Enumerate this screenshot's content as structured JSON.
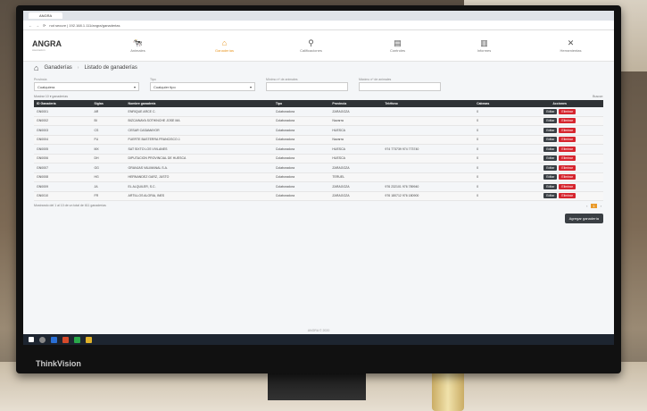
{
  "browser": {
    "tab_title": "ANGRA",
    "url": "not secure | 192.168.1.111/angra/ganaderias"
  },
  "app": {
    "logo": "ANGRA",
    "logo_sub": "Asociación"
  },
  "nav": [
    {
      "label": "Animales",
      "icon": "cow-icon",
      "glyph": "🐄"
    },
    {
      "label": "Ganaderías",
      "icon": "barn-icon",
      "glyph": "⌂"
    },
    {
      "label": "Calificaciones",
      "icon": "pin-icon",
      "glyph": "⚲"
    },
    {
      "label": "Controles",
      "icon": "document-icon",
      "glyph": "▤"
    },
    {
      "label": "Informes",
      "icon": "chart-icon",
      "glyph": "▥"
    },
    {
      "label": "Herramientas",
      "icon": "tools-icon",
      "glyph": "✕"
    }
  ],
  "breadcrumb": {
    "section": "Ganaderías",
    "page": "Listado de ganaderías"
  },
  "filters": {
    "provincia_label": "Provincia",
    "provincia_value": "Cualquiera",
    "tipo_label": "Tipo",
    "tipo_value": "Cualquier tipo",
    "min_label": "Mínimo nº de animales",
    "max_label": "Máximo nº de animales"
  },
  "list": {
    "show_text": "Mostrar 10 ▾ ganaderías",
    "search_label": "Buscar:"
  },
  "table": {
    "headers": [
      "ID Ganadería",
      "Siglas",
      "Nombre ganadería",
      "Tipo",
      "Provincia",
      "Teléfono",
      "Cabezas",
      "Acciones"
    ],
    "rows": [
      [
        "GN0001",
        "AR",
        "ENRIQUE ARCE C.",
        "Colaboradora",
        "ZARAGOZA",
        "",
        "0"
      ],
      [
        "GN0002",
        "BI",
        "BIZCAINAYA SOTHINCHE JOSE MA",
        "Colaboradora",
        "Navarra",
        "",
        "0"
      ],
      [
        "GN0003",
        "CS",
        "CESAR CASAMAYOR",
        "Colaboradora",
        "HUESCA",
        "",
        "0"
      ],
      [
        "GN0004",
        "FU",
        "FUERTE BASTERRA FRANCISCO J.",
        "Colaboradora",
        "Navarra",
        "",
        "0"
      ],
      [
        "GN0005",
        "MX",
        "SAT SIXTO LOS VIVLANES",
        "Colaboradora",
        "HUESCA",
        "974 773739 974 773740",
        "0"
      ],
      [
        "GN0006",
        "DH",
        "DIPUTACION PROVINCIAL DE HUESCA",
        "Colaboradora",
        "HUESCA",
        "",
        "0"
      ],
      [
        "GN0007",
        "GG",
        "GRANJAS VALIMANAL S.A.",
        "Colaboradora",
        "ZARAGOZA",
        "",
        "0"
      ],
      [
        "GN0008",
        "HG",
        "HERNANDEZ GARZ, JUSTO",
        "Colaboradora",
        "TERUEL",
        "",
        "0"
      ],
      [
        "GN0009",
        "JA",
        "EL ALQUILER, S.C.",
        "Colaboradora",
        "ZARAGOZA",
        "976 232101 976 789940",
        "0"
      ],
      [
        "GN0010",
        "FR",
        "ARTILLOS ALORIA, INES",
        "Colaboradora",
        "ZARAGOZA",
        "976 180712 976 180900",
        "0"
      ]
    ],
    "edit_label": "Editar",
    "delete_label": "Eliminar"
  },
  "footer_info": "Mostrando del 1 al 10 de un total de 611 ganaderías",
  "pager_current": "1",
  "add_button": "Agregar ganadería",
  "copyright": "ANGRA © 2020",
  "monitor_brand": "ThinkVision"
}
